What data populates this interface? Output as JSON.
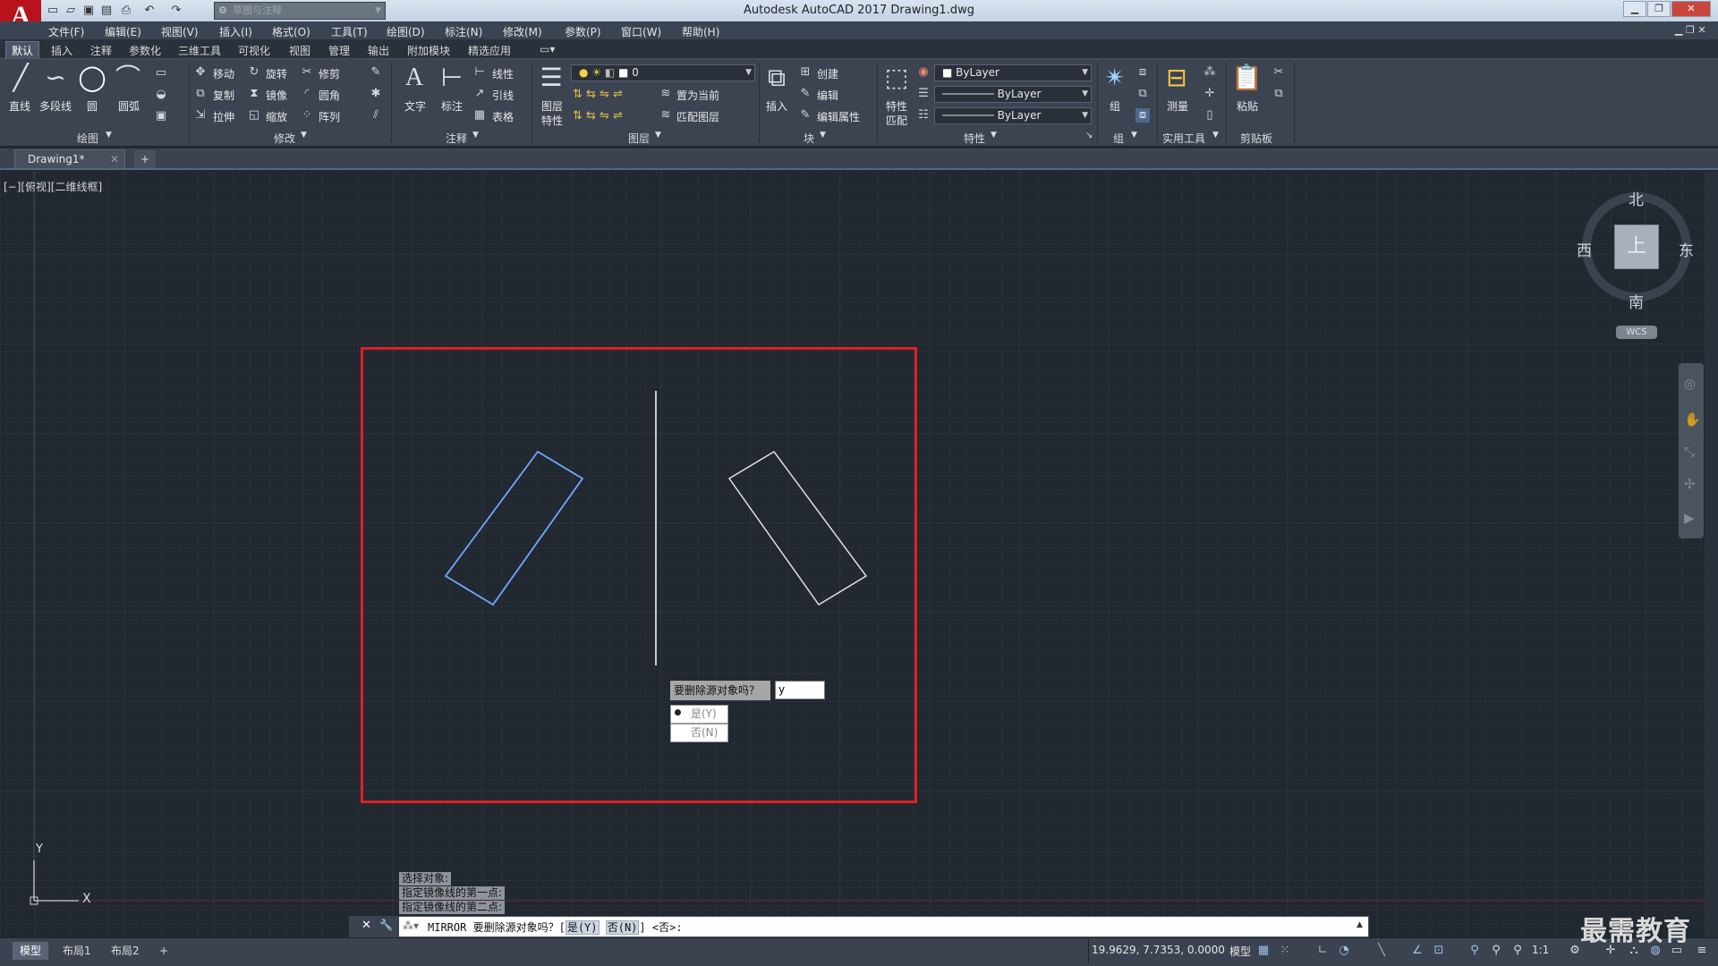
{
  "app": {
    "title": "Autodesk AutoCAD 2017    Drawing1.dwg",
    "logo_letter": "A",
    "workspace": "草图与注释"
  },
  "menu": [
    "文件(F)",
    "编辑(E)",
    "视图(V)",
    "插入(I)",
    "格式(O)",
    "工具(T)",
    "绘图(D)",
    "标注(N)",
    "修改(M)",
    "参数(P)",
    "窗口(W)",
    "帮助(H)"
  ],
  "ribbon_tabs": [
    "默认",
    "插入",
    "注释",
    "参数化",
    "三维工具",
    "可视化",
    "视图",
    "管理",
    "输出",
    "附加模块",
    "精选应用"
  ],
  "ribbon": {
    "draw": {
      "line": "直线",
      "polyline": "多段线",
      "circle": "圆",
      "arc": "圆弧",
      "title": "绘图"
    },
    "modify": {
      "move": "移动",
      "rotate": "旋转",
      "trim": "修剪",
      "copy": "复制",
      "mirror": "镜像",
      "fillet": "圆角",
      "stretch": "拉伸",
      "scale": "缩放",
      "array": "阵列",
      "title": "修改"
    },
    "annotation": {
      "text": "文字",
      "dimension": "标注",
      "linear": "线性",
      "leader": "引线",
      "table": "表格",
      "title": "注释"
    },
    "layers": {
      "properties_1": "图层",
      "properties_2": "特性",
      "layer_value": "0",
      "make_current": "置为当前",
      "match_layer": "匹配图层",
      "title": "图层"
    },
    "block": {
      "insert": "插入",
      "create": "创建",
      "edit": "编辑",
      "edit_attr": "编辑属性",
      "title": "块"
    },
    "properties": {
      "match_1": "特性",
      "match_2": "匹配",
      "color": "ByLayer",
      "linetype": "ByLayer",
      "lineweight": "ByLayer",
      "title": "特性"
    },
    "groups": {
      "group": "组",
      "title": "组"
    },
    "utilities": {
      "measure": "测量",
      "title": "实用工具"
    },
    "clipboard": {
      "paste": "粘贴",
      "title": "剪贴板"
    }
  },
  "doc_tab": "Drawing1*",
  "viewport_label": "[−][俯视][二维线框]",
  "viewcube": {
    "north": "北",
    "south": "南",
    "east": "东",
    "west": "西",
    "face": "上",
    "wcs": "WCS"
  },
  "prompt": {
    "question": "要删除源对象吗？",
    "input": "y",
    "option_yes": "是(Y)",
    "option_no": "否(N)"
  },
  "history": [
    "选择对象:",
    "指定镜像线的第一点:",
    "指定镜像线的第二点:"
  ],
  "command": {
    "prefix": "MIRROR 要删除源对象吗？[",
    "yes": "是(Y)",
    "no": "否(N)",
    "suffix": "] <否>:"
  },
  "layout_tabs": [
    "模型",
    "布局1",
    "布局2"
  ],
  "status": {
    "coords": "19.9629, 7.7353, 0.0000",
    "model": "模型",
    "scale": "1:1"
  },
  "ucs": {
    "x": "X",
    "y": "Y"
  },
  "watermark": "最需教育",
  "colors": {
    "frame": "#e02020",
    "selected": "#4d8de8",
    "canvas": "#212830"
  }
}
